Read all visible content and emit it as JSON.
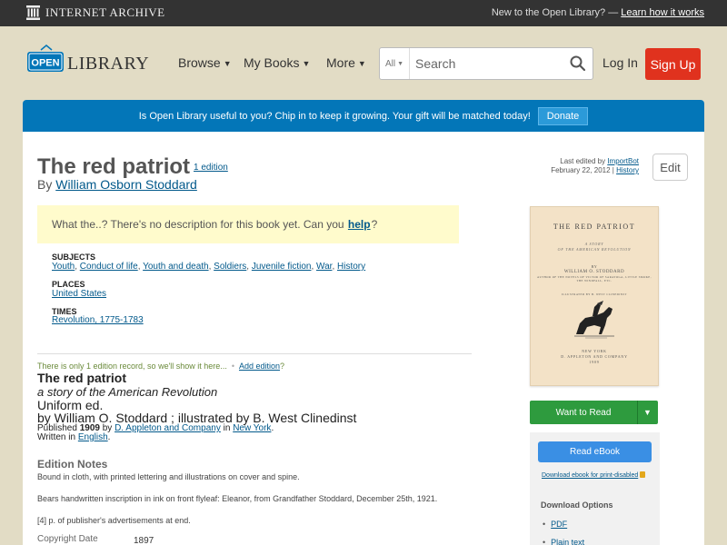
{
  "topbar": {
    "brand_small": "Internet Archive",
    "promo_text": "New to the Open Library? —",
    "promo_link": "Learn how it works"
  },
  "header": {
    "logo_text_open": "OPEN",
    "logo_text_library": "LIBRARY",
    "nav": [
      {
        "label": "Browse"
      },
      {
        "label": "My Books"
      },
      {
        "label": "More"
      }
    ],
    "search": {
      "scope": "All",
      "placeholder": "Search"
    },
    "login_label": "Log In",
    "signup_label": "Sign Up"
  },
  "donate": {
    "message": "Is Open Library useful to you? Chip in to keep it growing. Your gift will be matched today!",
    "button": "Donate"
  },
  "work": {
    "title": "The red patriot",
    "edition_count": "1 edition",
    "by_label": "By",
    "author": "William Osborn Stoddard",
    "last_edited_label": "Last edited by",
    "last_edited_user": "ImportBot",
    "last_edited_date": "February 22, 2012 |",
    "history_label": "History",
    "edit_label": "Edit",
    "no_description_prefix": "What the..? There's no description for this book yet. Can you",
    "no_description_link": "help",
    "no_description_suffix": "?",
    "subjects_label": "SUBJECTS",
    "subjects": [
      "Youth",
      "Conduct of life",
      "Youth and death",
      "Soldiers",
      "Juvenile fiction",
      "War",
      "History"
    ],
    "places_label": "PLACES",
    "places": [
      "United States"
    ],
    "times_label": "TIMES",
    "times": [
      "Revolution, 1775-1783"
    ]
  },
  "edition": {
    "only_one_note": "There is only 1 edition record, so we'll show it here...",
    "add_edition_link": "Add edition",
    "add_edition_suffix": "?",
    "title": "The red patriot",
    "subtitle": "a story of the American Revolution",
    "format": "Uniform ed.",
    "by_statement": "by William O. Stoddard ; illustrated by B. West Clinedinst",
    "published_label": "Published",
    "published_year": "1909",
    "published_by": "by",
    "publisher": "D. Appleton and Company",
    "published_in": "in",
    "place": "New York",
    "written_in_label": "Written in",
    "language": "English",
    "notes_heading": "Edition Notes",
    "notes": [
      "Bound in cloth, with printed lettering and illustrations on cover and spine.",
      "Bears handwritten inscription in ink on front flyleaf: Eleanor, from Grandfather Stoddard, December 25th, 1921.",
      "[4] p. of publisher's advertisements at end."
    ],
    "copyright_label": "Copyright Date",
    "copyright_value": "1897"
  },
  "cover": {
    "title": "THE RED PATRIOT",
    "subtitle_1": "A STORY",
    "subtitle_2": "OF THE AMERICAN REVOLUTION",
    "by": "BY",
    "author": "WILLIAM O. STODDARD",
    "author_note_1": "AUTHOR OF THE NOVELS OF VICTOR OF SARATOGA, LITTLE SMOKE,",
    "author_note_2": "THE WINDFALL, ETC.",
    "illustrated": "ILLUSTRATED BY B. WEST CLINEDINST",
    "pub_1": "NEW YORK",
    "pub_2": "D. APPLETON AND COMPANY",
    "pub_3": "1909"
  },
  "sidebar": {
    "want_to_read": "Want to Read",
    "read_ebook": "Read eBook",
    "print_disabled": "Download ebook for print-disabled",
    "download_heading": "Download Options",
    "downloads": [
      "PDF",
      "Plain text"
    ]
  },
  "colors": {
    "topbar": "#333333",
    "page_bg": "#e2dcc5",
    "donate_bar": "#0376b8",
    "signup": "#e0321e",
    "want_to_read": "#2e9b3e",
    "read_ebook": "#3a8fe4",
    "link": "#02598b",
    "no_description_bg": "#fffbcc"
  }
}
